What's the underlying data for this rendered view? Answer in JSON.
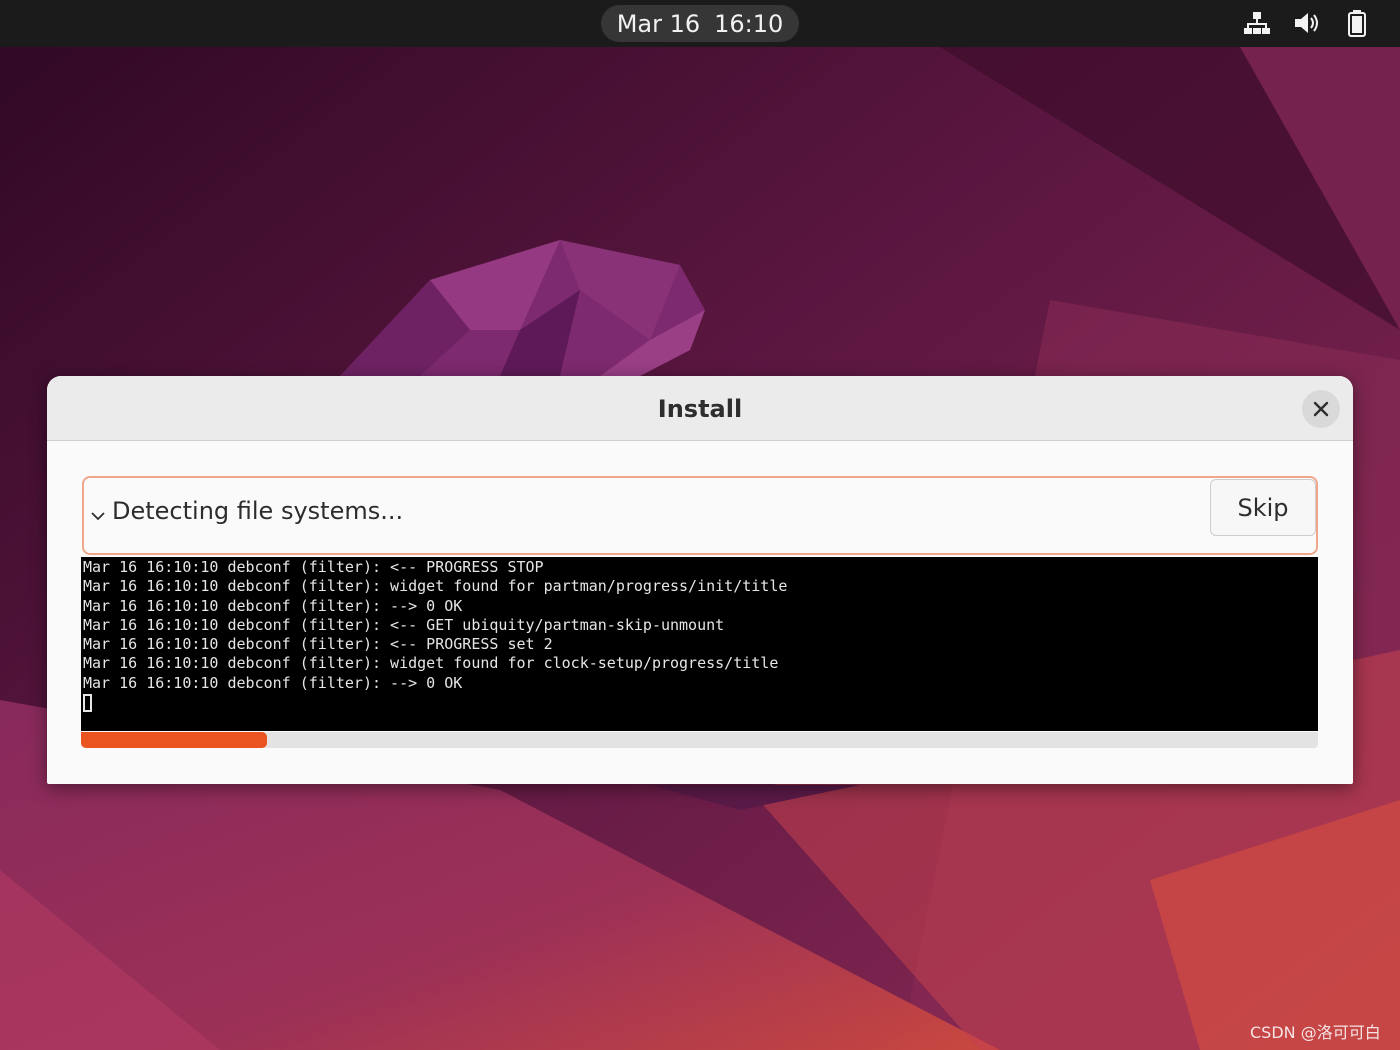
{
  "topbar": {
    "date": "Mar 16",
    "time": "16:10",
    "icons": [
      "network-icon",
      "volume-icon",
      "battery-icon"
    ]
  },
  "dialog": {
    "title": "Install",
    "status_text": "Detecting file systems...",
    "skip_label": "Skip",
    "progress": 0.15,
    "log_lines": [
      "Mar 16 16:10:10 debconf (filter): <-- PROGRESS STOP",
      "Mar 16 16:10:10 debconf (filter): widget found for partman/progress/init/title",
      "Mar 16 16:10:10 debconf (filter): --> 0 OK",
      "Mar 16 16:10:10 debconf (filter): <-- GET ubiquity/partman-skip-unmount",
      "Mar 16 16:10:10 debconf (filter): <-- PROGRESS set 2",
      "Mar 16 16:10:10 debconf (filter): widget found for clock-setup/progress/title",
      "Mar 16 16:10:10 debconf (filter): --> 0 OK"
    ]
  },
  "watermark": "CSDN @洛可可白",
  "colors": {
    "accent": "#e95420",
    "topbar": "#1b1b1b",
    "terminal_bg": "#000000"
  }
}
